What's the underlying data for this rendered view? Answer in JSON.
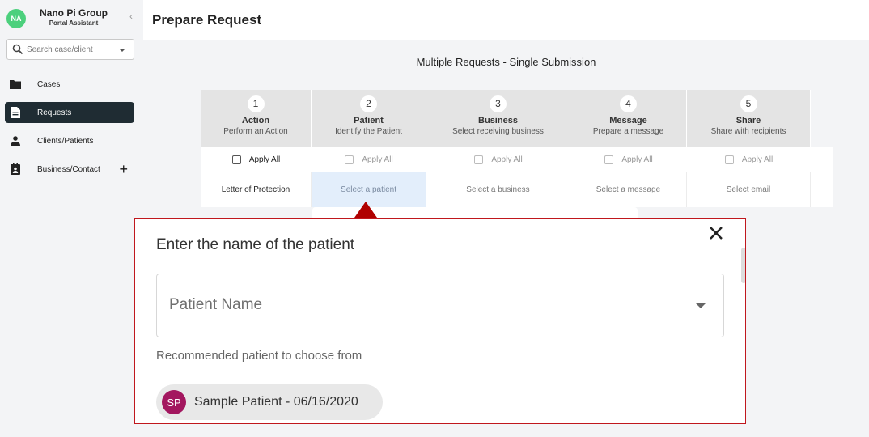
{
  "org": {
    "avatar": "NA",
    "name": "Nano Pi Group",
    "subtitle": "Portal Assistant",
    "avatar_color": "#4cd07d"
  },
  "sidebar": {
    "collapse_icon": "chevron-left-icon",
    "search_placeholder": "Search case/client",
    "items": [
      {
        "label": "Cases",
        "icon": "folder-icon",
        "active": false
      },
      {
        "label": "Requests",
        "icon": "document-icon",
        "active": true
      },
      {
        "label": "Clients/Patients",
        "icon": "person-icon",
        "active": false
      },
      {
        "label": "Business/Contact",
        "icon": "contact-card-icon",
        "active": false,
        "action": "+"
      }
    ]
  },
  "header": {
    "title": "Prepare Request"
  },
  "main": {
    "subtitle": "Multiple Requests - Single Submission",
    "steps": [
      {
        "num": "1",
        "title": "Action",
        "desc": "Perform an Action"
      },
      {
        "num": "2",
        "title": "Patient",
        "desc": "Identify the Patient"
      },
      {
        "num": "3",
        "title": "Business",
        "desc": "Select receiving business"
      },
      {
        "num": "4",
        "title": "Message",
        "desc": "Prepare a message"
      },
      {
        "num": "5",
        "title": "Share",
        "desc": "Share with recipients"
      }
    ],
    "apply_all": [
      "Apply All",
      "Apply All",
      "Apply All",
      "Apply All",
      "Apply All"
    ],
    "row": [
      "Letter of Protection",
      "Select a patient",
      "Select a business",
      "Select a message",
      "Select email"
    ]
  },
  "modal": {
    "title": "Enter the name of the patient",
    "field_label": "Patient Name",
    "recommended_label": "Recommended patient to choose from",
    "patient": {
      "initials": "SP",
      "name": "Sample Patient - 06/16/2020",
      "avatar_color": "#a3175f"
    },
    "border_color": "#c0171d"
  },
  "colors": {
    "active_nav": "#1f2c33",
    "selected_cell": "#e3eefb"
  }
}
